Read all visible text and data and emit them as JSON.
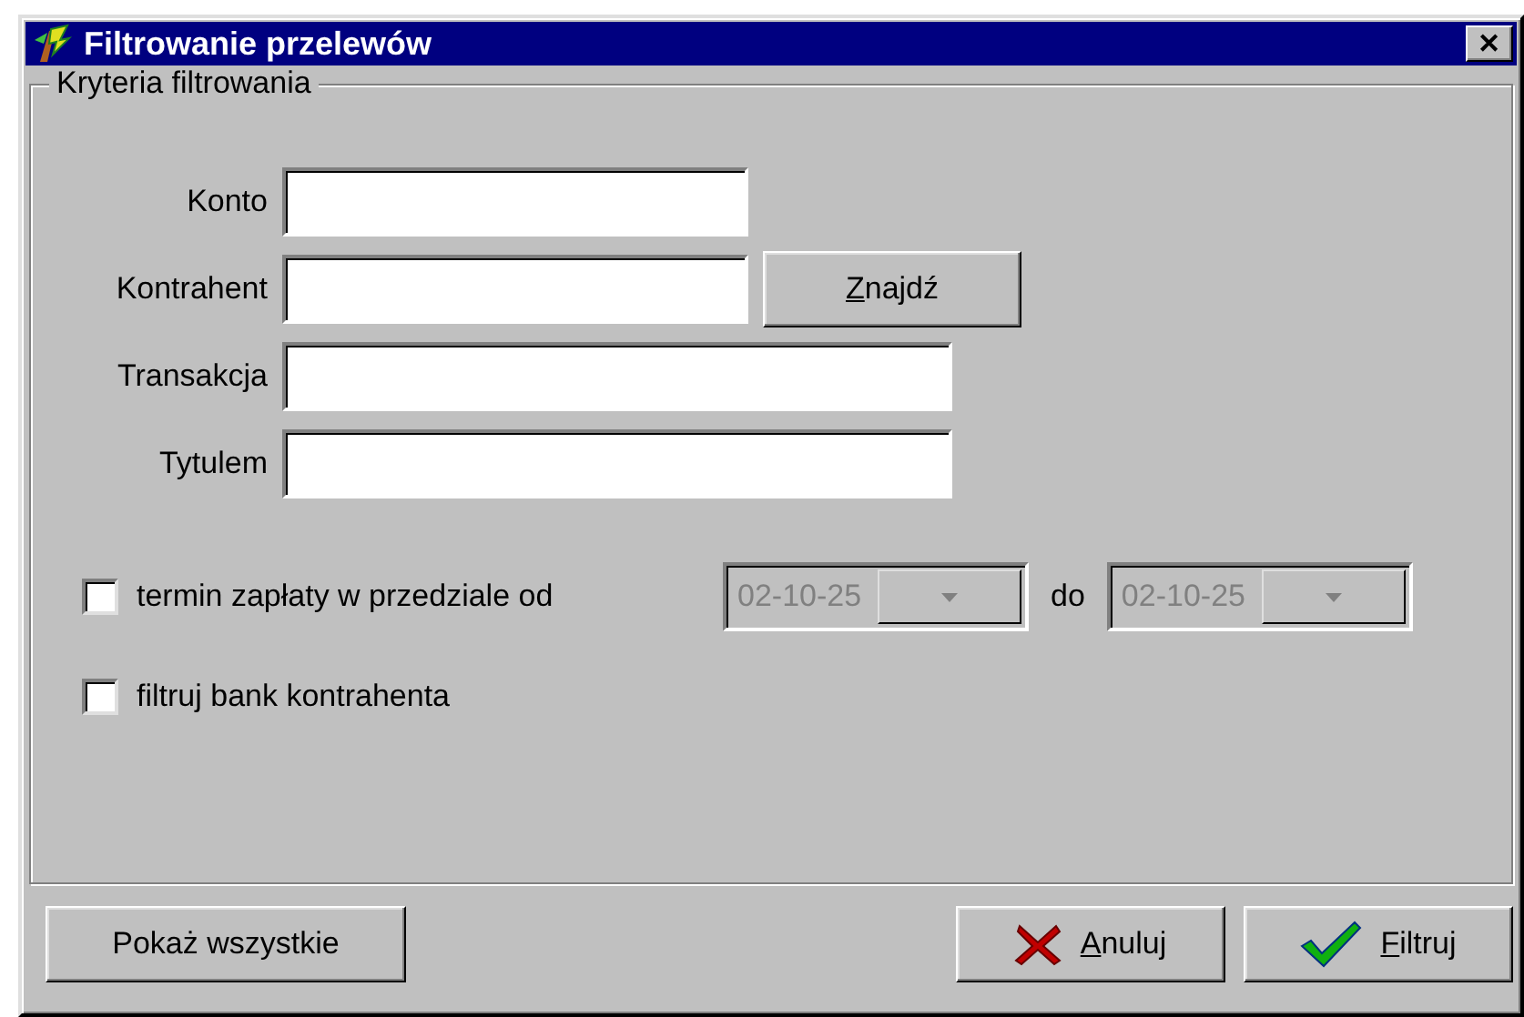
{
  "window": {
    "title": "Filtrowanie przelewów",
    "close_glyph": "✕"
  },
  "group": {
    "title": "Kryteria filtrowania",
    "fields": [
      {
        "label": "Konto"
      },
      {
        "label": "Kontrahent",
        "button": {
          "label": "Znajdź",
          "underline_first": true
        }
      },
      {
        "label": "Transakcja"
      },
      {
        "label": "Tytulem"
      }
    ],
    "date_filter": {
      "label": "termin zapłaty w przedziale od",
      "checked": false,
      "from": "02-10-25",
      "to_label": "do",
      "to": "02-10-25",
      "disabled": true
    },
    "bank_filter": {
      "label": "filtruj bank kontrahenta",
      "checked": false
    }
  },
  "buttons": [
    {
      "kind": "plain",
      "label": "Pokaż wszystkie",
      "underline_first": false
    },
    {
      "kind": "cancel",
      "label": "Anuluj",
      "underline_first": true
    },
    {
      "kind": "ok",
      "label": "Filtruj",
      "underline_first": true
    }
  ]
}
